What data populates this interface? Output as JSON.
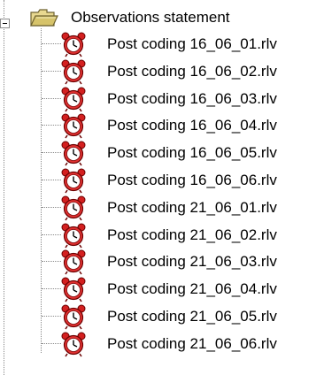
{
  "tree": {
    "root": {
      "label": "Observations statement",
      "icon": "folder-open-icon",
      "expanded": true
    },
    "children": [
      {
        "label": "Post coding 16_06_01.rlv",
        "icon": "alarm-clock-icon"
      },
      {
        "label": "Post coding 16_06_02.rlv",
        "icon": "alarm-clock-icon"
      },
      {
        "label": "Post coding 16_06_03.rlv",
        "icon": "alarm-clock-icon"
      },
      {
        "label": "Post coding 16_06_04.rlv",
        "icon": "alarm-clock-icon"
      },
      {
        "label": "Post coding 16_06_05.rlv",
        "icon": "alarm-clock-icon"
      },
      {
        "label": "Post coding 16_06_06.rlv",
        "icon": "alarm-clock-icon"
      },
      {
        "label": "Post coding 21_06_01.rlv",
        "icon": "alarm-clock-icon"
      },
      {
        "label": "Post coding 21_06_02.rlv",
        "icon": "alarm-clock-icon"
      },
      {
        "label": "Post coding 21_06_03.rlv",
        "icon": "alarm-clock-icon"
      },
      {
        "label": "Post coding 21_06_04.rlv",
        "icon": "alarm-clock-icon"
      },
      {
        "label": "Post coding 21_06_05.rlv",
        "icon": "alarm-clock-icon"
      },
      {
        "label": "Post coding 21_06_06.rlv",
        "icon": "alarm-clock-icon"
      }
    ]
  },
  "colors": {
    "folder": "#d6c36a",
    "folder_dark": "#8a7a3a",
    "clock_red": "#d42020",
    "line": "#8a8a8a"
  }
}
